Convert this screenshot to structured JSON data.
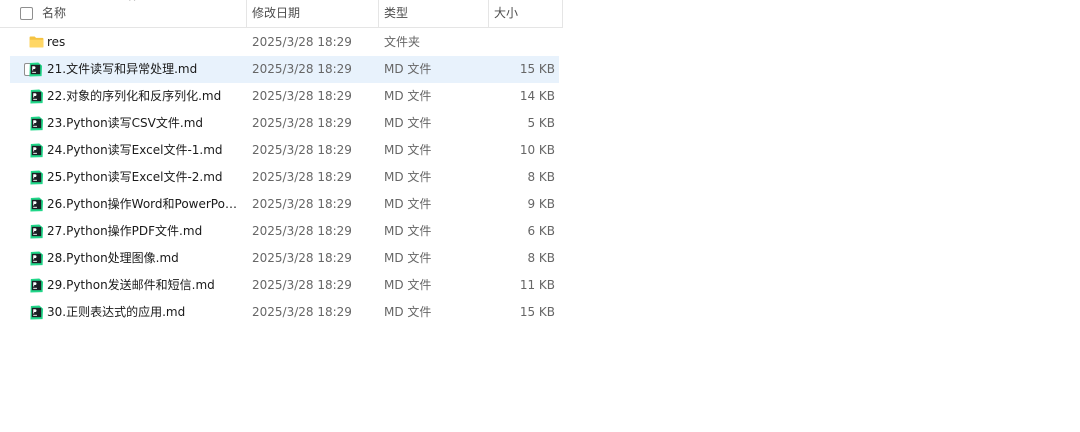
{
  "header": {
    "name": "名称",
    "modified": "修改日期",
    "type": "类型",
    "size": "大小",
    "sort_indicator": "^"
  },
  "files": [
    {
      "name": "res",
      "modified": "2025/3/28 18:29",
      "type": "文件夹",
      "size": "",
      "icon": "folder-icon",
      "hovered": false
    },
    {
      "name": "21.文件读写和异常处理.md",
      "modified": "2025/3/28 18:29",
      "type": "MD 文件",
      "size": "15 KB",
      "icon": "md-file-icon",
      "hovered": true
    },
    {
      "name": "22.对象的序列化和反序列化.md",
      "modified": "2025/3/28 18:29",
      "type": "MD 文件",
      "size": "14 KB",
      "icon": "md-file-icon",
      "hovered": false
    },
    {
      "name": "23.Python读写CSV文件.md",
      "modified": "2025/3/28 18:29",
      "type": "MD 文件",
      "size": "5 KB",
      "icon": "md-file-icon",
      "hovered": false
    },
    {
      "name": "24.Python读写Excel文件-1.md",
      "modified": "2025/3/28 18:29",
      "type": "MD 文件",
      "size": "10 KB",
      "icon": "md-file-icon",
      "hovered": false
    },
    {
      "name": "25.Python读写Excel文件-2.md",
      "modified": "2025/3/28 18:29",
      "type": "MD 文件",
      "size": "8 KB",
      "icon": "md-file-icon",
      "hovered": false
    },
    {
      "name": "26.Python操作Word和PowerPoint...",
      "modified": "2025/3/28 18:29",
      "type": "MD 文件",
      "size": "9 KB",
      "icon": "md-file-icon",
      "hovered": false
    },
    {
      "name": "27.Python操作PDF文件.md",
      "modified": "2025/3/28 18:29",
      "type": "MD 文件",
      "size": "6 KB",
      "icon": "md-file-icon",
      "hovered": false
    },
    {
      "name": "28.Python处理图像.md",
      "modified": "2025/3/28 18:29",
      "type": "MD 文件",
      "size": "8 KB",
      "icon": "md-file-icon",
      "hovered": false
    },
    {
      "name": "29.Python发送邮件和短信.md",
      "modified": "2025/3/28 18:29",
      "type": "MD 文件",
      "size": "11 KB",
      "icon": "md-file-icon",
      "hovered": false
    },
    {
      "name": "30.正则表达式的应用.md",
      "modified": "2025/3/28 18:29",
      "type": "MD 文件",
      "size": "15 KB",
      "icon": "md-file-icon",
      "hovered": false
    }
  ],
  "colors": {
    "hover_bg": "#e8f2fc",
    "folder": "#f5c342",
    "md_icon_bg": "#1b1f24",
    "md_icon_accent": "#21d789"
  }
}
